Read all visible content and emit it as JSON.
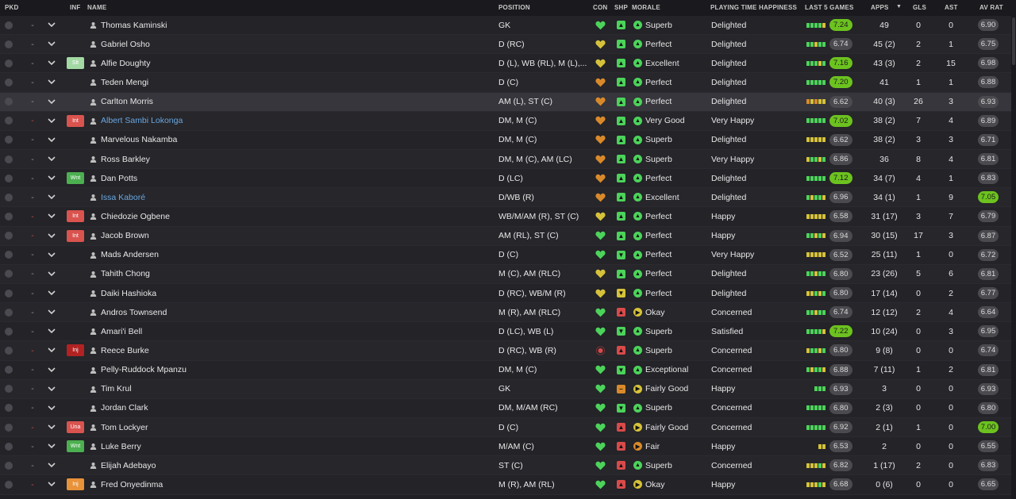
{
  "headers": {
    "pkd": "PKD",
    "inf": "INF",
    "name": "NAME",
    "position": "POSITION",
    "con": "CON",
    "shp": "SHP",
    "morale": "MORALE",
    "pth": "PLAYING TIME HAPPINESS",
    "last5": "LAST 5 GAMES",
    "apps": "APPS",
    "apps_sort_icon": "▼",
    "gls": "GLS",
    "ast": "AST",
    "avrat": "AV RAT"
  },
  "colors": {
    "green": "#4cd35a",
    "yellow": "#d6c23a",
    "orange": "#d9892a",
    "red": "#d94a4a",
    "hi_rating": "#6cc21f",
    "blue_name": "#6aa7e0"
  },
  "players": [
    {
      "dash": "-",
      "inf": "",
      "name": "Thomas Kaminski",
      "position": "GK",
      "con": "green",
      "shp": "green",
      "shp_icon": "up-arrow",
      "morale": "Superb",
      "morale_color": "green",
      "morale_icon": "up-arrow",
      "pth": "Delighted",
      "last5": [
        "g",
        "g",
        "g",
        "g",
        "y"
      ],
      "last5_val": "7.24",
      "last5_hi": true,
      "apps": "49",
      "gls": "0",
      "ast": "0",
      "avrat": "6.90",
      "avrat_hi": false
    },
    {
      "dash": "-",
      "inf": "",
      "name": "Gabriel Osho",
      "position": "D (RC)",
      "con": "yellow",
      "shp": "green",
      "shp_icon": "up-arrow",
      "morale": "Perfect",
      "morale_color": "green",
      "morale_icon": "up-arrow",
      "pth": "Delighted",
      "last5": [
        "g",
        "g",
        "y",
        "g",
        "g"
      ],
      "last5_val": "6.74",
      "last5_hi": false,
      "apps": "45 (2)",
      "gls": "2",
      "ast": "1",
      "avrat": "6.75",
      "avrat_hi": false
    },
    {
      "dash": "-",
      "inf": "Slt",
      "inf_color": "#a3d9a3",
      "name": "Alfie Doughty",
      "position": "D (L), WB (RL), M (L),...",
      "con": "yellow",
      "shp": "green",
      "shp_icon": "up-arrow",
      "morale": "Excellent",
      "morale_color": "green",
      "morale_icon": "up-arrow",
      "pth": "Delighted",
      "last5": [
        "g",
        "g",
        "g",
        "y",
        "g"
      ],
      "last5_val": "7.16",
      "last5_hi": true,
      "apps": "43 (3)",
      "gls": "2",
      "ast": "15",
      "avrat": "6.98",
      "avrat_hi": false
    },
    {
      "dash": "-",
      "inf": "",
      "name": "Teden Mengi",
      "position": "D (C)",
      "con": "orange",
      "shp": "green",
      "shp_icon": "up-arrow",
      "morale": "Perfect",
      "morale_color": "green",
      "morale_icon": "up-arrow",
      "pth": "Delighted",
      "last5": [
        "g",
        "g",
        "g",
        "g",
        "g"
      ],
      "last5_val": "7.20",
      "last5_hi": true,
      "apps": "41",
      "gls": "1",
      "ast": "1",
      "avrat": "6.88",
      "avrat_hi": false
    },
    {
      "dash": "-",
      "inf": "",
      "name": "Carlton Morris",
      "position": "AM (L), ST (C)",
      "con": "orange",
      "shp": "green",
      "shp_icon": "up-arrow",
      "morale": "Perfect",
      "morale_color": "green",
      "morale_icon": "up-arrow",
      "pth": "Delighted",
      "last5": [
        "o",
        "y",
        "o",
        "y",
        "y"
      ],
      "last5_val": "6.62",
      "last5_hi": false,
      "apps": "40 (3)",
      "gls": "26",
      "ast": "3",
      "avrat": "6.93",
      "avrat_hi": false,
      "selected": true
    },
    {
      "dash": "-",
      "dash_red": true,
      "inf": "Int",
      "inf_color": "#d9534f",
      "name": "Albert Sambi Lokonga",
      "name_blue": true,
      "position": "DM, M (C)",
      "con": "orange",
      "shp": "green",
      "shp_icon": "up-arrow",
      "morale": "Very Good",
      "morale_color": "green",
      "morale_icon": "up-arrow",
      "pth": "Very Happy",
      "last5": [
        "g",
        "g",
        "g",
        "g",
        "g"
      ],
      "last5_val": "7.02",
      "last5_hi": true,
      "apps": "38 (2)",
      "gls": "7",
      "ast": "4",
      "avrat": "6.89",
      "avrat_hi": false
    },
    {
      "dash": "-",
      "inf": "",
      "name": "Marvelous Nakamba",
      "position": "DM, M (C)",
      "con": "orange",
      "shp": "green",
      "shp_icon": "up-arrow",
      "morale": "Superb",
      "morale_color": "green",
      "morale_icon": "up-arrow",
      "pth": "Delighted",
      "last5": [
        "y",
        "y",
        "y",
        "y",
        "y"
      ],
      "last5_val": "6.62",
      "last5_hi": false,
      "apps": "38 (2)",
      "gls": "3",
      "ast": "3",
      "avrat": "6.71",
      "avrat_hi": false
    },
    {
      "dash": "-",
      "inf": "",
      "name": "Ross Barkley",
      "position": "DM, M (C), AM (LC)",
      "con": "orange",
      "shp": "green",
      "shp_icon": "up-arrow",
      "morale": "Superb",
      "morale_color": "green",
      "morale_icon": "up-arrow",
      "pth": "Very Happy",
      "last5": [
        "y",
        "g",
        "g",
        "y",
        "g"
      ],
      "last5_val": "6.86",
      "last5_hi": false,
      "apps": "36",
      "gls": "8",
      "ast": "4",
      "avrat": "6.81",
      "avrat_hi": false
    },
    {
      "dash": "-",
      "inf": "Wnt",
      "inf_color": "#4caf50",
      "name": "Dan Potts",
      "position": "D (LC)",
      "con": "orange",
      "shp": "green",
      "shp_icon": "up-arrow",
      "morale": "Perfect",
      "morale_color": "green",
      "morale_icon": "up-arrow",
      "pth": "Delighted",
      "last5": [
        "g",
        "g",
        "g",
        "g",
        "g"
      ],
      "last5_val": "7.12",
      "last5_hi": true,
      "apps": "34 (7)",
      "gls": "4",
      "ast": "1",
      "avrat": "6.83",
      "avrat_hi": false
    },
    {
      "dash": "-",
      "inf": "",
      "name": "Issa Kaboré",
      "name_blue": true,
      "position": "D/WB (R)",
      "con": "orange",
      "shp": "green",
      "shp_icon": "up-arrow",
      "morale": "Excellent",
      "morale_color": "green",
      "morale_icon": "up-arrow",
      "pth": "Delighted",
      "last5": [
        "g",
        "y",
        "g",
        "g",
        "y"
      ],
      "last5_val": "6.96",
      "last5_hi": false,
      "apps": "34 (1)",
      "gls": "1",
      "ast": "9",
      "avrat": "7.05",
      "avrat_hi": true
    },
    {
      "dash": "-",
      "dash_red": true,
      "inf": "Int",
      "inf_color": "#d9534f",
      "name": "Chiedozie Ogbene",
      "position": "WB/M/AM (R), ST (C)",
      "con": "yellow",
      "shp": "green",
      "shp_icon": "up-arrow",
      "morale": "Perfect",
      "morale_color": "green",
      "morale_icon": "up-arrow",
      "pth": "Happy",
      "last5": [
        "y",
        "y",
        "y",
        "y",
        "y"
      ],
      "last5_val": "6.58",
      "last5_hi": false,
      "apps": "31 (17)",
      "gls": "3",
      "ast": "7",
      "avrat": "6.79",
      "avrat_hi": false
    },
    {
      "dash": "-",
      "dash_red": true,
      "inf": "Int",
      "inf_color": "#d9534f",
      "name": "Jacob Brown",
      "position": "AM (RL), ST (C)",
      "con": "green",
      "shp": "green",
      "shp_icon": "up-arrow",
      "morale": "Perfect",
      "morale_color": "green",
      "morale_icon": "up-arrow",
      "pth": "Happy",
      "last5": [
        "g",
        "g",
        "y",
        "g",
        "y"
      ],
      "last5_val": "6.94",
      "last5_hi": false,
      "apps": "30 (15)",
      "gls": "17",
      "ast": "3",
      "avrat": "6.87",
      "avrat_hi": false
    },
    {
      "dash": "-",
      "inf": "",
      "name": "Mads Andersen",
      "position": "D (C)",
      "con": "green",
      "shp": "green",
      "shp_icon": "down-arrow",
      "morale": "Perfect",
      "morale_color": "green",
      "morale_icon": "up-arrow",
      "pth": "Very Happy",
      "last5": [
        "y",
        "y",
        "y",
        "y",
        "y"
      ],
      "last5_val": "6.52",
      "last5_hi": false,
      "apps": "25 (11)",
      "gls": "1",
      "ast": "0",
      "avrat": "6.72",
      "avrat_hi": false
    },
    {
      "dash": "-",
      "inf": "",
      "name": "Tahith Chong",
      "position": "M (C), AM (RLC)",
      "con": "yellow",
      "shp": "green",
      "shp_icon": "up-arrow",
      "morale": "Perfect",
      "morale_color": "green",
      "morale_icon": "up-arrow",
      "pth": "Delighted",
      "last5": [
        "g",
        "g",
        "y",
        "g",
        "g"
      ],
      "last5_val": "6.80",
      "last5_hi": false,
      "apps": "23 (26)",
      "gls": "5",
      "ast": "6",
      "avrat": "6.81",
      "avrat_hi": false
    },
    {
      "dash": "-",
      "inf": "",
      "name": "Daiki Hashioka",
      "position": "D (RC), WB/M (R)",
      "con": "yellow",
      "shp": "yellow",
      "shp_icon": "down-arrow",
      "morale": "Perfect",
      "morale_color": "green",
      "morale_icon": "up-arrow",
      "pth": "Delighted",
      "last5": [
        "y",
        "y",
        "g",
        "y",
        "g"
      ],
      "last5_val": "6.80",
      "last5_hi": false,
      "apps": "17 (14)",
      "gls": "0",
      "ast": "2",
      "avrat": "6.77",
      "avrat_hi": false
    },
    {
      "dash": "-",
      "inf": "",
      "name": "Andros Townsend",
      "position": "M (R), AM (RLC)",
      "con": "green",
      "shp": "red",
      "shp_icon": "up-arrow",
      "morale": "Okay",
      "morale_color": "yellow",
      "morale_icon": "right-arrow",
      "pth": "Concerned",
      "last5": [
        "g",
        "g",
        "y",
        "g",
        "g"
      ],
      "last5_val": "6.74",
      "last5_hi": false,
      "apps": "12 (12)",
      "gls": "2",
      "ast": "4",
      "avrat": "6.64",
      "avrat_hi": false
    },
    {
      "dash": "-",
      "inf": "",
      "name": "Amari'i Bell",
      "position": "D (LC), WB (L)",
      "con": "green",
      "shp": "green",
      "shp_icon": "down-arrow",
      "morale": "Superb",
      "morale_color": "green",
      "morale_icon": "up-arrow",
      "pth": "Satisfied",
      "last5": [
        "g",
        "g",
        "g",
        "g",
        "y"
      ],
      "last5_val": "7.22",
      "last5_hi": true,
      "apps": "10 (24)",
      "gls": "0",
      "ast": "3",
      "avrat": "6.95",
      "avrat_hi": false
    },
    {
      "dash": "-",
      "dash_red": true,
      "inf": "Inj",
      "inf_color": "#b22222",
      "name": "Reece Burke",
      "position": "D (RC), WB (R)",
      "con": "injury",
      "shp": "red",
      "shp_icon": "up-arrow",
      "morale": "Superb",
      "morale_color": "green",
      "morale_icon": "up-arrow",
      "pth": "Concerned",
      "last5": [
        "y",
        "g",
        "g",
        "y",
        "g"
      ],
      "last5_val": "6.80",
      "last5_hi": false,
      "apps": "9 (8)",
      "gls": "0",
      "ast": "0",
      "avrat": "6.74",
      "avrat_hi": false
    },
    {
      "dash": "-",
      "inf": "",
      "name": "Pelly-Ruddock Mpanzu",
      "position": "DM, M (C)",
      "con": "green",
      "shp": "green",
      "shp_icon": "down-arrow",
      "morale": "Exceptional",
      "morale_color": "green",
      "morale_icon": "up-arrow",
      "pth": "Concerned",
      "last5": [
        "g",
        "y",
        "g",
        "g",
        "y"
      ],
      "last5_val": "6.88",
      "last5_hi": false,
      "apps": "7 (11)",
      "gls": "1",
      "ast": "2",
      "avrat": "6.81",
      "avrat_hi": false
    },
    {
      "dash": "-",
      "inf": "",
      "name": "Tim Krul",
      "position": "GK",
      "con": "green",
      "shp": "orange",
      "shp_icon": "minus",
      "morale": "Fairly Good",
      "morale_color": "yellow",
      "morale_icon": "right-arrow",
      "pth": "Happy",
      "last5": [
        "",
        "",
        "g",
        "g",
        "g"
      ],
      "last5_val": "6.93",
      "last5_hi": false,
      "apps": "3",
      "gls": "0",
      "ast": "0",
      "avrat": "6.93",
      "avrat_hi": false
    },
    {
      "dash": "-",
      "inf": "",
      "name": "Jordan Clark",
      "position": "DM, M/AM (RC)",
      "con": "green",
      "shp": "green",
      "shp_icon": "down-arrow",
      "morale": "Superb",
      "morale_color": "green",
      "morale_icon": "up-arrow",
      "pth": "Concerned",
      "last5": [
        "g",
        "g",
        "g",
        "g",
        "g"
      ],
      "last5_val": "6.80",
      "last5_hi": false,
      "apps": "2 (3)",
      "gls": "0",
      "ast": "0",
      "avrat": "6.80",
      "avrat_hi": false
    },
    {
      "dash": "-",
      "dash_red": true,
      "inf": "Una",
      "inf_color": "#d9534f",
      "name": "Tom Lockyer",
      "position": "D (C)",
      "con": "green",
      "shp": "red",
      "shp_icon": "up-arrow",
      "morale": "Fairly Good",
      "morale_color": "yellow",
      "morale_icon": "right-arrow",
      "pth": "Concerned",
      "last5": [
        "g",
        "g",
        "g",
        "g",
        "g"
      ],
      "last5_val": "6.92",
      "last5_hi": false,
      "apps": "2 (1)",
      "gls": "1",
      "ast": "0",
      "avrat": "7.00",
      "avrat_hi": true
    },
    {
      "dash": "-",
      "inf": "Wnt",
      "inf_color": "#4caf50",
      "name": "Luke Berry",
      "position": "M/AM (C)",
      "con": "green",
      "shp": "red",
      "shp_icon": "up-arrow",
      "morale": "Fair",
      "morale_color": "orange",
      "morale_icon": "right-arrow",
      "pth": "Happy",
      "last5": [
        "",
        "",
        "",
        "y",
        "y"
      ],
      "last5_val": "6.53",
      "last5_hi": false,
      "apps": "2",
      "gls": "0",
      "ast": "0",
      "avrat": "6.55",
      "avrat_hi": false
    },
    {
      "dash": "-",
      "inf": "",
      "name": "Elijah Adebayo",
      "position": "ST (C)",
      "con": "green",
      "shp": "red",
      "shp_icon": "up-arrow",
      "morale": "Superb",
      "morale_color": "green",
      "morale_icon": "up-arrow",
      "pth": "Concerned",
      "last5": [
        "y",
        "y",
        "y",
        "g",
        "y"
      ],
      "last5_val": "6.82",
      "last5_hi": false,
      "apps": "1 (17)",
      "gls": "2",
      "ast": "0",
      "avrat": "6.83",
      "avrat_hi": false
    },
    {
      "dash": "-",
      "dash_red": true,
      "inf": "Inj",
      "inf_color": "#e8923a",
      "name": "Fred Onyedinma",
      "position": "M (R), AM (RL)",
      "con": "green",
      "shp": "red",
      "shp_icon": "up-arrow",
      "morale": "Okay",
      "morale_color": "yellow",
      "morale_icon": "right-arrow",
      "pth": "Happy",
      "last5": [
        "y",
        "y",
        "y",
        "g",
        "y"
      ],
      "last5_val": "6.68",
      "last5_hi": false,
      "apps": "0 (6)",
      "gls": "0",
      "ast": "0",
      "avrat": "6.65",
      "avrat_hi": false
    }
  ]
}
